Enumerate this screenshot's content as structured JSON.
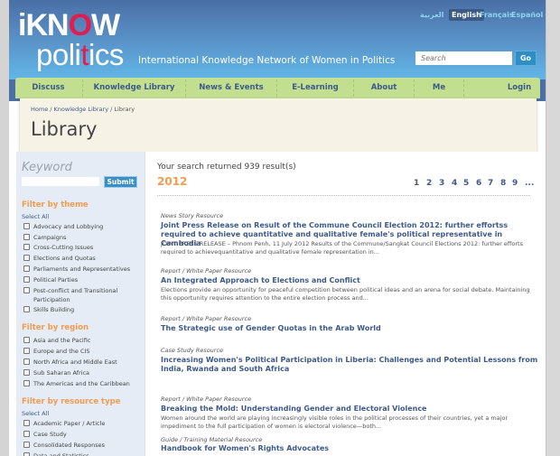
{
  "header": {
    "logo_top": [
      "iKN",
      "O",
      "W"
    ],
    "logo_bottom": [
      "poli",
      "t",
      "ics"
    ],
    "tagline": "International Knowledge Network of Women in Politics",
    "languages": [
      {
        "label": "العربية",
        "active": false
      },
      {
        "label": "English",
        "active": true
      },
      {
        "label": "Français",
        "active": false
      },
      {
        "label": "Español",
        "active": false
      }
    ],
    "search_placeholder": "Search",
    "go_label": "Go"
  },
  "nav": {
    "items": [
      "Discuss",
      "Knowledge Library",
      "News & Events",
      "E-Learning",
      "About",
      "Me",
      "Login"
    ]
  },
  "breadcrumb": {
    "items": [
      "Home",
      "Knowledge Library",
      "Library"
    ],
    "separator": " / "
  },
  "page_title": "Library",
  "sidebar": {
    "keyword_label": "Keyword",
    "submit_label": "Submit",
    "theme": {
      "title": "Filter by theme",
      "select_all": "Select All",
      "options": [
        "Advocacy and Lobbying",
        "Campaigns",
        "Cross-Cutting Issues",
        "Elections and Quotas",
        "Parliaments and Representatives",
        "Political Parties",
        "Post-conflict and Transitional Participation",
        "Skills Building"
      ]
    },
    "region": {
      "title": "Filter by region",
      "options": [
        "Asia and the Pacific",
        "Europe and the CIS",
        "North Africa and Middle East",
        "Sub Saharan Africa",
        "The Americas and the Caribbean"
      ]
    },
    "resource_type": {
      "title": "Filter by resource type",
      "select_all": "Select All",
      "options": [
        "Academic Paper / Article",
        "Case Study",
        "Consolidated Responses",
        "Data and Statistics"
      ]
    }
  },
  "main": {
    "result_count": "Your search returned 939 result(s)",
    "year": "2012",
    "pages": [
      "1",
      "2",
      "3",
      "4",
      "5",
      "6",
      "7",
      "8",
      "9",
      "..."
    ],
    "current_page": "1",
    "results": [
      {
        "type": "News Story Resource",
        "title": "Joint Press Release on Result of the Commune Council Election 2012: further effortss required to achieve quantitative and qualitative female's political representative in Cambodia",
        "desc": "JOINT PRESS RELEASE – Phnom Penh, 11 July 2012 Results of the Commune/Sangkat Council Elections 2012: further efforts required to achievequantitative and qualitative female representation in..."
      },
      {
        "type": "Report / White Paper Resource",
        "title": "An Integrated Approach to Elections and Conflict",
        "desc": "Elections provide an opportunity for peaceful competition between political ideas and an arena for social debate. Maintaining this opportunity requires attention to the entire election process and..."
      },
      {
        "type": "Report / White Paper Resource",
        "title": "The Strategic use of Gender Quotas in the Arab World",
        "desc": ""
      },
      {
        "type": "Case Study Resource",
        "title": "Increasing Women's Political Participation in Liberia: Challenges and Potential Lessons from India, Rwanda and South Africa",
        "desc": ""
      },
      {
        "type": "Report / White Paper Resource",
        "title": "Breaking the Mold: Understanding Gender and Electoral Violence",
        "desc": "Women around the world are playing increasingly visible roles in the political processes of their countries, yet a major impediment to the full participation of women is electoral violence—both..."
      },
      {
        "type": "Guide / Training Material Resource",
        "title": "Handbook for Women's Rights Advocates",
        "desc": ""
      }
    ]
  }
}
